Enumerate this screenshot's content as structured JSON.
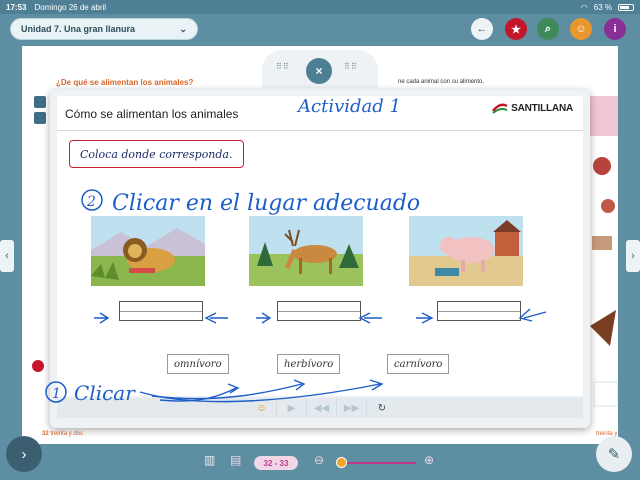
{
  "status": {
    "time": "17:53",
    "date": "Domingo 26 de abril",
    "battery": "63 %"
  },
  "nav": {
    "unit_title": "Unidad 7. Una gran llanura",
    "buttons": [
      {
        "name": "back",
        "glyph": "←",
        "color": "#eef3f5"
      },
      {
        "name": "star",
        "glyph": "★",
        "color": "#c4162a"
      },
      {
        "name": "search",
        "glyph": "⌕",
        "color": "#3f8a5a"
      },
      {
        "name": "person",
        "glyph": "☺",
        "color": "#e9962c"
      },
      {
        "name": "info",
        "glyph": "i",
        "color": "#8a2f96"
      }
    ]
  },
  "book": {
    "question": "¿De qué se alimentan los animales?",
    "question_right": "ne cada animal con su alimento.",
    "page_left": "32",
    "page_left_text": "treinta y dos",
    "page_right_text": "treinta y"
  },
  "modal": {
    "title": "Cómo se alimentan los animales",
    "brand": "SANTILLANA",
    "instruction": "Coloca donde corresponda.",
    "words": [
      "omnívoro",
      "herbívoro",
      "carnívoro"
    ]
  },
  "handwriting": {
    "title_note": "Actividad 1",
    "step2": "Clicar en el lugar adecuado",
    "step2_number": "2",
    "step1": "Clicar",
    "step1_number": "1"
  },
  "bottom": {
    "pages": "32 - 33"
  },
  "icons": {
    "close": "×",
    "next": "›",
    "pencil": "✎"
  }
}
